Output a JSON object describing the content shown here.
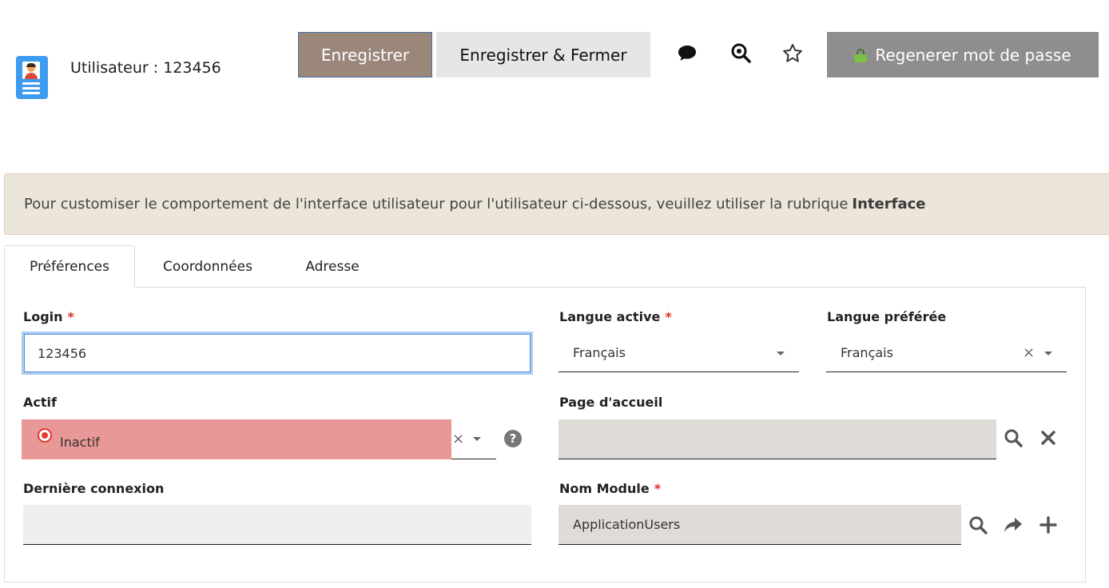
{
  "header": {
    "title": "Utilisateur : 123456",
    "doc_icon": "user-card-icon"
  },
  "toolbar": {
    "save_label": "Enregistrer",
    "save_close_label": "Enregistrer & Fermer",
    "comment_icon": "comment-icon",
    "search_icon": "zoom-search-icon",
    "favorite_icon": "star-icon",
    "regen_label": "Regenerer mot de passe",
    "regen_icon": "lock-icon"
  },
  "banner": {
    "text": "Pour customiser le comportement de l'interface utilisateur pour l'utilisateur ci-dessous, veuillez utiliser la rubrique",
    "link": "Interface"
  },
  "tabs": [
    {
      "label": "Préférences",
      "active": true
    },
    {
      "label": "Coordonnées",
      "active": false
    },
    {
      "label": "Adresse",
      "active": false
    }
  ],
  "form": {
    "login": {
      "label": "Login",
      "required_mark": "*",
      "value": "123456"
    },
    "langue_active": {
      "label": "Langue active",
      "required_mark": "*",
      "value": "Français"
    },
    "langue_preferee": {
      "label": "Langue préférée",
      "value": "Français"
    },
    "actif": {
      "label": "Actif",
      "value": "Inactif"
    },
    "page_accueil": {
      "label": "Page d'accueil",
      "value": ""
    },
    "derniere_connexion": {
      "label": "Dernière connexion",
      "value": ""
    },
    "nom_module": {
      "label": "Nom Module",
      "required_mark": "*",
      "value": "ApplicationUsers"
    }
  },
  "colors": {
    "save_button": "#9a877a",
    "regen_button": "#8e8e8e",
    "banner_bg": "#ece6da",
    "inactive_bg": "#e89896",
    "required": "#d93025"
  }
}
